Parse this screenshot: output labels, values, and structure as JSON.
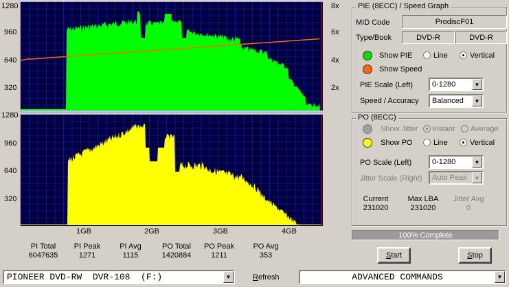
{
  "graph": {
    "pie_left_ticks": [
      "1280",
      "960",
      "640",
      "320"
    ],
    "pie_right_ticks": [
      "8x",
      "6x",
      "4x",
      "2x"
    ],
    "po_left_ticks": [
      "1280",
      "960",
      "640",
      "320"
    ],
    "x_ticks": [
      "1GB",
      "2GB",
      "3GB",
      "4GB"
    ],
    "colors": {
      "pie": "#00ff00",
      "po": "#ffff00",
      "speed": "#ff6a00",
      "bg": "#000040",
      "grid": "#2020c0",
      "marker": "#c00000"
    }
  },
  "stats": [
    {
      "label": "PI Total",
      "value": "6047635"
    },
    {
      "label": "PI Peak",
      "value": "1271"
    },
    {
      "label": "PI Avg",
      "value": "1115"
    },
    {
      "label": "PO Total",
      "value": "1420884"
    },
    {
      "label": "PO Peak",
      "value": "1211"
    },
    {
      "label": "PO Avg",
      "value": "353"
    }
  ],
  "pie_panel": {
    "title": "PIE (8ECC) / Speed Graph",
    "mid_code_label": "MID Code",
    "mid_code_value": "ProdiscF01",
    "type_book_label": "Type/Book",
    "type_value": "DVD-R",
    "book_value": "DVD-R",
    "show_pie": "Show PIE",
    "show_speed": "Show Speed",
    "line_label": "Line",
    "vertical_label": "Vertical",
    "scale_label": "PIE Scale (Left)",
    "scale_value": "0-1280",
    "speed_label": "Speed / Accuracy",
    "speed_value": "Balanced"
  },
  "po_panel": {
    "title": "PO (8ECC)",
    "show_jitter": "Show Jitter",
    "instant_label": "Instant",
    "average_label": "Average",
    "show_po": "Show PO",
    "line_label": "Line",
    "vertical_label": "Vertical",
    "scale_label": "PO Scale (Left)",
    "scale_value": "0-1280",
    "jitter_scale_label": "Jitter Scale (Right)",
    "jitter_scale_value": "Auto Peak",
    "current_label": "Current",
    "current_value": "231020",
    "maxlba_label": "Max LBA",
    "maxlba_value": "231020",
    "jitter_avg_label": "Jitter Avg",
    "jitter_avg_value": "0"
  },
  "progress": {
    "text": "100% Complete",
    "percent": 100
  },
  "buttons": {
    "start": "Start",
    "stop": "Stop",
    "refresh": "Refresh"
  },
  "drive": {
    "value": "PIONEER DVD-RW  DVR-108  (F:)"
  },
  "commands": {
    "value": "ADVANCED COMMANDS"
  }
}
